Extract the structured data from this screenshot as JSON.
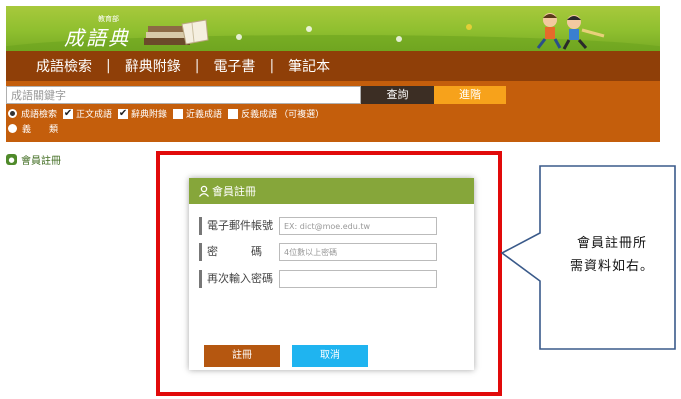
{
  "banner": {
    "logo_small": "教育部",
    "logo_main": "成語典"
  },
  "nav": {
    "items": [
      "成語檢索",
      "辭典附錄",
      "電子書",
      "筆記本"
    ],
    "separator": "|"
  },
  "search": {
    "placeholder": "成語關鍵字",
    "query_button": "查詢",
    "advanced_button": "進階",
    "options": {
      "radio_idiom": "成語檢索",
      "check_main": "正文成語",
      "check_appendix": "辭典附錄",
      "check_synonym": "近義成語",
      "check_antonym": "反義成語",
      "note": "（可複選）",
      "radio_meaning": "義　　類"
    },
    "checked": {
      "main": true,
      "appendix": true,
      "synonym": false,
      "antonym": false
    }
  },
  "sidebar": {
    "member_link": "會員註冊"
  },
  "modal": {
    "title": "會員註冊",
    "fields": {
      "email_label": "電子郵件帳號",
      "email_placeholder": "EX: dict@moe.edu.tw",
      "password_label": "密　　　碼",
      "password_placeholder": "4位數以上密碼",
      "confirm_label": "再次輸入密碼",
      "confirm_placeholder": ""
    },
    "register_button": "註冊",
    "cancel_button": "取消"
  },
  "callout": {
    "line1": "會員註冊所",
    "line2": "需資料如右。"
  },
  "colors": {
    "banner_green": "#8fbf2f",
    "nav_brown": "#8f3f08",
    "search_orange": "#c45e0c",
    "query_dark": "#3c2e24",
    "advanced_orange": "#f7a21b",
    "modal_header_green": "#86a63a",
    "register_brown": "#b55710",
    "cancel_blue": "#1fb4f0",
    "highlight_red": "#e10a0a",
    "callout_border": "#3a5a8a"
  }
}
